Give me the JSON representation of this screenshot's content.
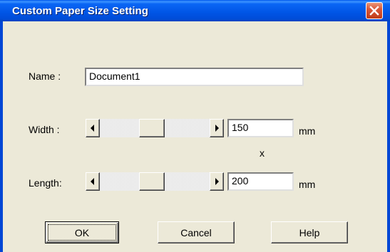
{
  "window": {
    "title": "Custom Paper Size Setting"
  },
  "form": {
    "name_label": "Name :",
    "name_value": "Document1",
    "width_label": "Width :",
    "width_value": "150",
    "width_unit": "mm",
    "separator": "x",
    "length_label": "Length:",
    "length_value": "200",
    "length_unit": "mm"
  },
  "buttons": {
    "ok": "OK",
    "cancel": "Cancel",
    "help": "Help"
  },
  "icons": {
    "close": "close-icon",
    "left": "left-arrow-icon",
    "right": "right-arrow-icon"
  },
  "colors": {
    "title_bar": "#0055e5",
    "face": "#ece9d8",
    "close_button": "#d8573a"
  }
}
